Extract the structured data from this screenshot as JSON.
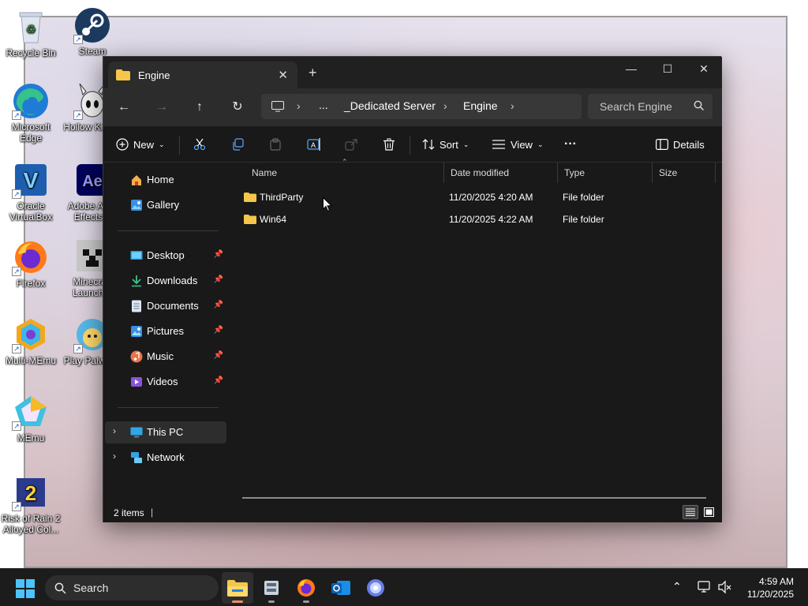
{
  "desktop": {
    "icons": [
      {
        "label": "Recycle Bin"
      },
      {
        "label": "Steam"
      },
      {
        "label": "Microsoft Edge"
      },
      {
        "label": "Hollow Knight"
      },
      {
        "label": "Oracle VirtualBox"
      },
      {
        "label": "Adobe After Effects 2"
      },
      {
        "label": "Firefox"
      },
      {
        "label": "Minecraft Launcher"
      },
      {
        "label": "Multi-MEmu"
      },
      {
        "label": "Play Palworld"
      },
      {
        "label": "MEmu"
      },
      {
        "label": "Risk of Rain 2 Alloyed Col..."
      }
    ]
  },
  "window": {
    "tab_title": "Engine",
    "new_tab": "+",
    "controls": {
      "minimize": "—",
      "maximize": "☐",
      "close": "✕"
    },
    "breadcrumb": [
      "...",
      "_Dedicated Server",
      "Engine"
    ],
    "search_placeholder": "Search Engine",
    "commands": {
      "new_label": "New",
      "sort_label": "Sort",
      "view_label": "View",
      "more_label": "···",
      "details_label": "Details"
    },
    "nav": {
      "top": [
        {
          "label": "Home",
          "icon": "home-icon"
        },
        {
          "label": "Gallery",
          "icon": "gallery-icon"
        }
      ],
      "quick_access": [
        {
          "label": "Desktop",
          "icon": "desktop-folder-icon"
        },
        {
          "label": "Downloads",
          "icon": "downloads-icon"
        },
        {
          "label": "Documents",
          "icon": "documents-icon"
        },
        {
          "label": "Pictures",
          "icon": "pictures-icon"
        },
        {
          "label": "Music",
          "icon": "music-icon"
        },
        {
          "label": "Videos",
          "icon": "videos-icon"
        }
      ],
      "locations": [
        {
          "label": "This PC",
          "icon": "this-pc-icon"
        },
        {
          "label": "Network",
          "icon": "network-icon"
        }
      ]
    },
    "columns": {
      "name": "Name",
      "date": "Date modified",
      "type": "Type",
      "size": "Size"
    },
    "files": [
      {
        "name": "ThirdParty",
        "date": "11/20/2025 4:20 AM",
        "type": "File folder",
        "size": ""
      },
      {
        "name": "Win64",
        "date": "11/20/2025 4:22 AM",
        "type": "File folder",
        "size": ""
      }
    ],
    "status": "2 items"
  },
  "taskbar": {
    "search_label": "Search",
    "time": "4:59 AM",
    "date": "11/20/2025"
  },
  "colors": {
    "window_bg": "#191919",
    "navbar_bg": "#2c2c2c",
    "folder": "#f4c64a",
    "accent": "#4aa3ff",
    "taskbar_bg": "#1c1c1c"
  }
}
